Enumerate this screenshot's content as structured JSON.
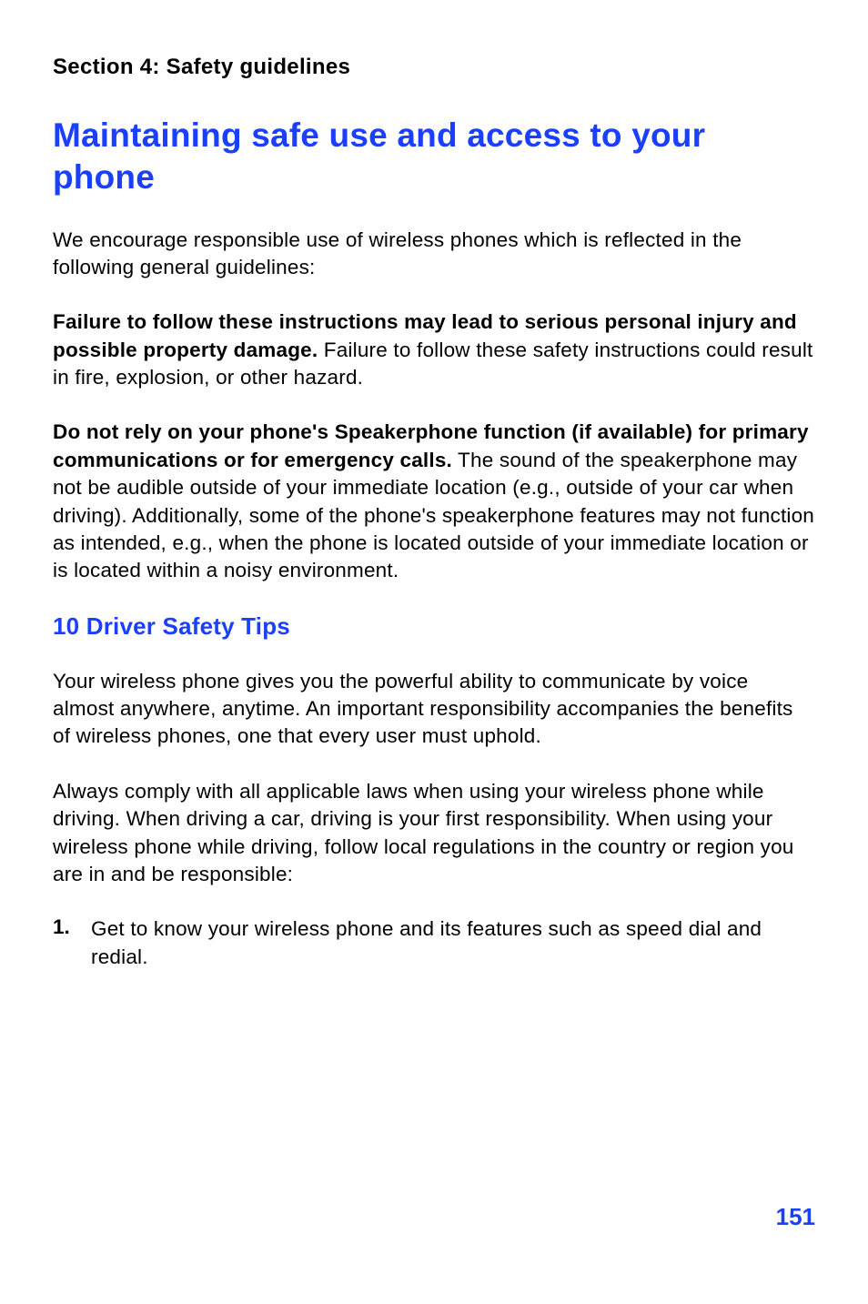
{
  "header": {
    "section": "Section 4: Safety guidelines"
  },
  "main": {
    "title": "Maintaining safe use and access to your phone",
    "intro": "We encourage responsible use of wireless phones which is reflected in the following general guidelines:",
    "para1_bold": "Failure to follow these instructions may lead to serious personal injury and possible property damage.",
    "para1_rest": " Failure to follow these safety instructions could result in fire, explosion, or other hazard.",
    "para2_bold": "Do not rely on your phone's Speakerphone function (if available) for primary communications or for emergency calls.",
    "para2_rest": " The sound of the speakerphone may not be audible outside of your immediate location (e.g., outside of your car when driving). Additionally, some of the phone's speakerphone features may not function as intended, e.g., when the phone is located outside of your immediate location or is located within a noisy environment.",
    "subheading": "10 Driver Safety Tips",
    "para3": "Your wireless phone gives you the powerful ability to communicate by voice almost anywhere, anytime. An important responsibility accompanies the benefits of wireless phones, one that every user must uphold.",
    "para4": "Always comply with all applicable laws when using your wireless phone while driving. When driving a car, driving is your first responsibility. When using your wireless phone while driving, follow local regulations in the country or region you are in and be responsible:",
    "list": {
      "num1": "1.",
      "item1": "Get to know your wireless phone and its features such as speed dial and redial."
    }
  },
  "footer": {
    "page": "151"
  }
}
